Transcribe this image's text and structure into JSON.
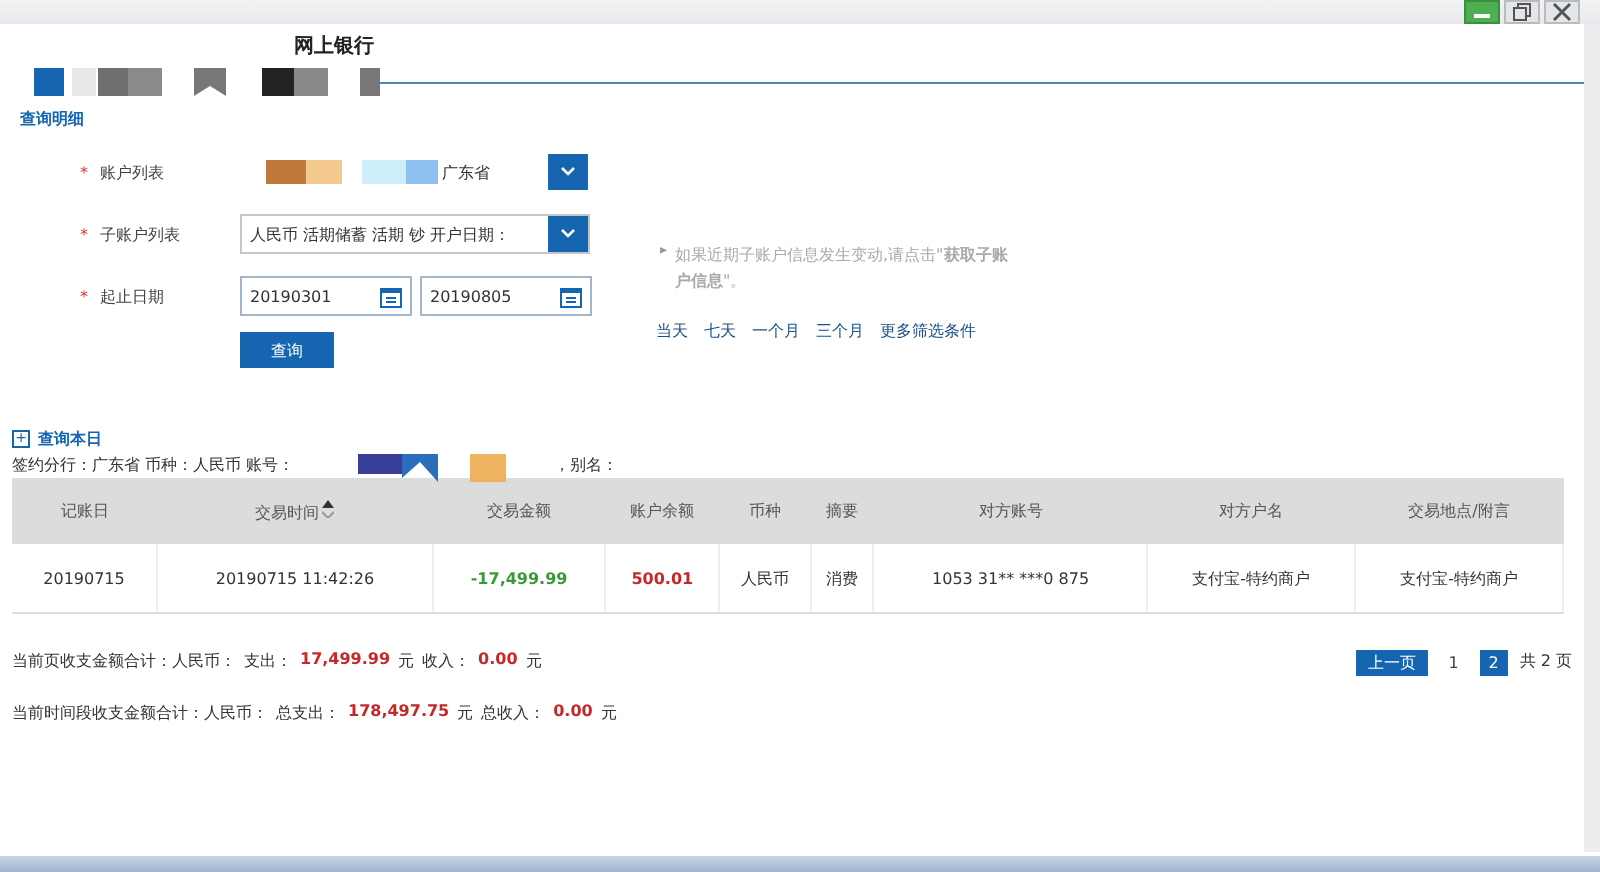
{
  "header": {
    "title": "网上银行"
  },
  "section": {
    "title": "查询明细"
  },
  "form": {
    "rows": [
      {
        "kind": "account_select",
        "required": "*",
        "label": "账户列表",
        "value": "广东省"
      },
      {
        "kind": "select",
        "required": "*",
        "label": "子账户列表",
        "value": "人民币 活期储蓄 活期 钞 开户日期："
      },
      {
        "kind": "dates",
        "required": "*",
        "label": "起止日期",
        "from": "20190301",
        "to": "20190805"
      }
    ],
    "query_button": "查询",
    "note": {
      "marker": "▸",
      "text": "如果近期子账户信息发生变动,请点击\"**获取子账户信息**\"。"
    },
    "quick_links": [
      "当天",
      "七天",
      "一个月",
      "三个月",
      "更多筛选条件"
    ]
  },
  "today": {
    "marker": "+",
    "label": "查询本日"
  },
  "account_info": {
    "text_before": "签约分行：广东省 币种：人民币 账号：",
    "text_after": "，别名："
  },
  "table": {
    "columns": [
      {
        "label": "记账日",
        "sortable": false
      },
      {
        "label": "交易时间",
        "sortable": true
      },
      {
        "label": "交易金额",
        "sortable": false
      },
      {
        "label": "账户余额",
        "sortable": false
      },
      {
        "label": "币种",
        "sortable": false
      },
      {
        "label": "摘要",
        "sortable": false
      },
      {
        "label": "对方账号",
        "sortable": false
      },
      {
        "label": "对方户名",
        "sortable": false
      },
      {
        "label": "交易地点/附言",
        "sortable": false
      }
    ],
    "rows": [
      {
        "cells": [
          {
            "text": "20190715",
            "kind": "plain"
          },
          {
            "text": "20190715 11:42:26",
            "kind": "plain"
          },
          {
            "text": "-17,499.99",
            "kind": "debit"
          },
          {
            "text": "500.01",
            "kind": "balance"
          },
          {
            "text": "人民币",
            "kind": "plain"
          },
          {
            "text": "消费",
            "kind": "plain"
          },
          {
            "text": "1053 31** ***0 875",
            "kind": "plain"
          },
          {
            "text": "支付宝-特约商户",
            "kind": "plain"
          },
          {
            "text": "支付宝-特约商户",
            "kind": "plain"
          }
        ]
      }
    ]
  },
  "totals": [
    {
      "label": "当前页收支金额合计：人民币：",
      "out_label": "支出：",
      "out": "17,499.99",
      "unit": "元",
      "in_label": "收入：",
      "in": "0.00",
      "unit2": "元"
    },
    {
      "label": "当前时间段收支金额合计：人民币：",
      "out_label": "总支出：",
      "out": "178,497.75",
      "unit": "元",
      "in_label": "总收入：",
      "in": "0.00",
      "unit2": "元"
    }
  ],
  "pager": {
    "prev": "上一页",
    "pages": [
      {
        "label": "1",
        "selected": false
      },
      {
        "label": "2",
        "selected": true
      }
    ],
    "total": "共 2 页"
  }
}
